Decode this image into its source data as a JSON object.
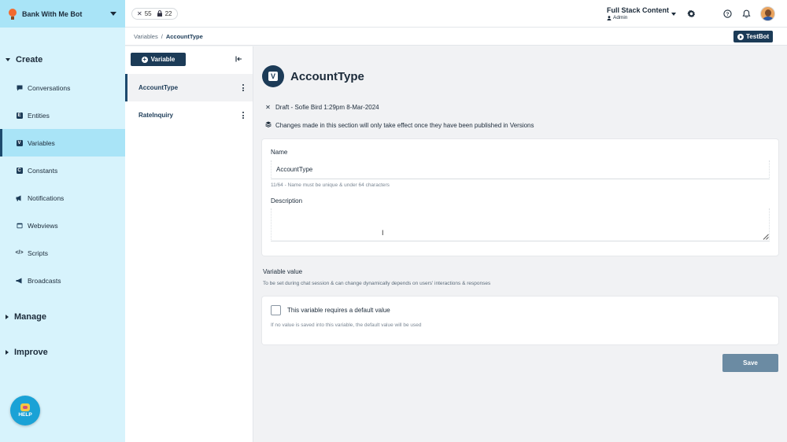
{
  "app": {
    "bot_name": "Bank With Me Bot",
    "stats": {
      "tools_count": "55",
      "locks_count": "22"
    },
    "user": {
      "name": "Full Stack Content",
      "role": "Admin"
    },
    "avatar_alt": "user avatar"
  },
  "sidebar": {
    "sections": {
      "create": "Create",
      "manage": "Manage",
      "improve": "Improve"
    },
    "items": [
      {
        "label": "Conversations",
        "icon": "chat-icon"
      },
      {
        "label": "Entities",
        "icon": "entity-icon"
      },
      {
        "label": "Variables",
        "icon": "variable-icon"
      },
      {
        "label": "Constants",
        "icon": "constant-icon"
      },
      {
        "label": "Notifications",
        "icon": "megaphone-icon"
      },
      {
        "label": "Webviews",
        "icon": "browser-icon"
      },
      {
        "label": "Scripts",
        "icon": "code-icon"
      },
      {
        "label": "Broadcasts",
        "icon": "broadcast-icon"
      }
    ],
    "help_label": "HELP"
  },
  "breadcrumb": {
    "parent": "Variables",
    "separator": "/",
    "current": "AccountType"
  },
  "toolbar": {
    "testbot_label": "TestBot"
  },
  "list": {
    "add_label": "Variable",
    "items": [
      {
        "label": "AccountType"
      },
      {
        "label": "RateInquiry"
      }
    ]
  },
  "detail": {
    "icon_letter": "V",
    "title": "AccountType",
    "draft_info": "Draft - Sofie Bird 1:29pm 8-Mar-2024",
    "publish_note": "Changes made in this section will only take effect once they have been published in Versions",
    "name_label": "Name",
    "name_value": "AccountType",
    "name_hint": "11/64 - Name must be unique & under 64 characters",
    "description_label": "Description",
    "description_value": "",
    "variable_value_title": "Variable value",
    "variable_value_sub": "To be set during chat session & can change dynamically depends on users' interactions & responses",
    "default_checkbox_label": "This variable requires a default value",
    "default_checkbox_checked": false,
    "default_hint": "If no value is saved into this variable, the default value will be used",
    "save_label": "Save"
  },
  "colors": {
    "accent": "#1c3b57",
    "sidebar_bg": "#d7f3fc",
    "sidebar_active": "#a9e4f7",
    "save_button": "#6b8ba3"
  }
}
